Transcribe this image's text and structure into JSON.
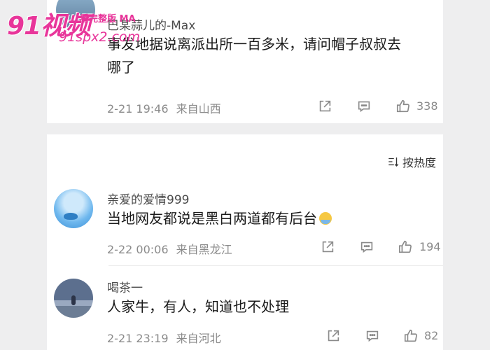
{
  "watermark": {
    "logo": "91视频",
    "tagline": "看完整版 MA",
    "url": "91spx2.com"
  },
  "comments": [
    {
      "username": "巴某蒜儿的-Max",
      "content_line1": "事发地据说离派出所一百多米，请问帽子叔叔去",
      "content_line2": "哪了",
      "date": "2-21 19:46",
      "location": "来自山西",
      "likes": "338"
    },
    {
      "username": "亲爱的爱情999",
      "content_line1": "当地网友都说是黑白两道都有后台",
      "date": "2-22 00:06",
      "location": "来自黑龙江",
      "likes": "194"
    },
    {
      "username": "喝茶一",
      "content_line1": "人家牛，有人，知道也不处理",
      "date": "2-21 23:19",
      "location": "来自河北",
      "likes": "82"
    }
  ],
  "sort": {
    "label": "按热度"
  },
  "icons": {
    "share": "share-icon",
    "comment": "comment-icon",
    "like": "thumb-up-icon",
    "sort": "sort-icon"
  }
}
